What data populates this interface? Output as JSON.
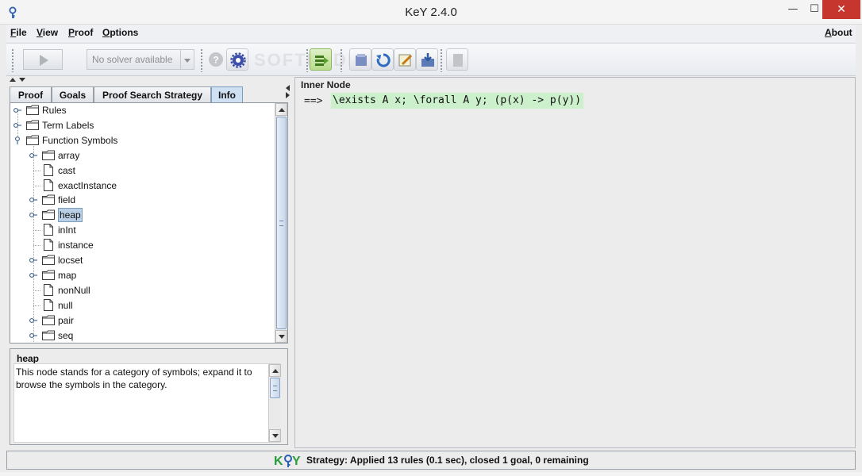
{
  "window": {
    "title": "KeY 2.4.0",
    "minimize_glyph": "—",
    "maximize_glyph": "☐",
    "close_glyph": "✕"
  },
  "menu": {
    "items": [
      {
        "mnemonic": "F",
        "rest": "ile"
      },
      {
        "mnemonic": "V",
        "rest": "iew"
      },
      {
        "mnemonic": "P",
        "rest": "roof"
      },
      {
        "mnemonic": "O",
        "rest": "ptions"
      }
    ],
    "about": {
      "mnemonic": "A",
      "rest": "bout"
    }
  },
  "toolbar": {
    "solver_label": "No solver available",
    "icons": [
      "play-icon",
      "help-icon",
      "settings-gear-icon",
      "goal-back-icon",
      "prune-icon",
      "open-icon",
      "reload-icon",
      "edit-icon",
      "save-icon",
      "close-proof-icon"
    ]
  },
  "left_panel": {
    "tabs": [
      "Proof",
      "Goals",
      "Proof Search Strategy",
      "Info"
    ],
    "active_tab": "Info",
    "tree": [
      {
        "label": "Rules",
        "type": "folder",
        "level": 0,
        "expandable": true
      },
      {
        "label": "Term Labels",
        "type": "folder",
        "level": 0,
        "expandable": true
      },
      {
        "label": "Function Symbols",
        "type": "folder",
        "level": 0,
        "expandable": true,
        "expanded": true
      },
      {
        "label": "array",
        "type": "folder",
        "level": 1,
        "expandable": true
      },
      {
        "label": "cast",
        "type": "leaf",
        "level": 1
      },
      {
        "label": "exactInstance",
        "type": "leaf",
        "level": 1
      },
      {
        "label": "field",
        "type": "folder",
        "level": 1,
        "expandable": true
      },
      {
        "label": "heap",
        "type": "folder",
        "level": 1,
        "expandable": true,
        "selected": true
      },
      {
        "label": "inInt",
        "type": "leaf",
        "level": 1
      },
      {
        "label": "instance",
        "type": "leaf",
        "level": 1
      },
      {
        "label": "locset",
        "type": "folder",
        "level": 1,
        "expandable": true
      },
      {
        "label": "map",
        "type": "folder",
        "level": 1,
        "expandable": true
      },
      {
        "label": "nonNull",
        "type": "leaf",
        "level": 1
      },
      {
        "label": "null",
        "type": "leaf",
        "level": 1
      },
      {
        "label": "pair",
        "type": "folder",
        "level": 1,
        "expandable": true
      },
      {
        "label": "seq",
        "type": "folder",
        "level": 1,
        "expandable": true
      }
    ],
    "info": {
      "title": "heap",
      "text": "This node stands for a category of symbols; expand it to browse the symbols in the category."
    }
  },
  "right_panel": {
    "title": "Inner Node",
    "sequent_arrow": "==>",
    "formula": "\\exists A x; \\forall A y; (p(x) -> p(y))",
    "highlight_color": "#ccf0cc"
  },
  "status": {
    "logo": "KeY",
    "text": "Strategy: Applied 13 rules (0.1 sec),  closed 1 goal, 0 remaining"
  },
  "colors": {
    "accent_selection": "#b8cfe5",
    "close_button": "#c7352f",
    "logo_green": "#2a9a3a",
    "logo_blue": "#2b5fb4"
  }
}
